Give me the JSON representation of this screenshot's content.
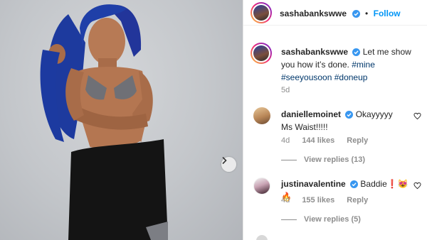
{
  "post": {
    "author": "sashabankswwe",
    "follow_label": "Follow",
    "separator": "•",
    "caption": {
      "username": "sashabankswwe",
      "text": "Let me show you how it’s done.",
      "hashtags": [
        "#mine",
        "#seeyousoon",
        "#doneup"
      ],
      "age": "5d"
    }
  },
  "comments": [
    {
      "username": "daniellemoinet",
      "text": "Okayyyyy Ms Waist!!!!!",
      "age": "4d",
      "likes": "144 likes",
      "reply_label": "Reply",
      "view_replies": "View replies (13)"
    },
    {
      "username": "justinavalentine",
      "text": "Baddie❗️😻🔥",
      "age": "4d",
      "likes": "155 likes",
      "reply_label": "Reply",
      "view_replies": "View replies (5)"
    }
  ],
  "icons": {
    "next": "chevron-right-icon",
    "verified": "verified-badge-icon",
    "like": "heart-outline-icon"
  },
  "colors": {
    "link_blue": "#0095f6",
    "hashtag": "#00376b",
    "verified": "#3897f0",
    "muted": "#8e8e8e",
    "hair_blue": "#1f3fa8"
  }
}
